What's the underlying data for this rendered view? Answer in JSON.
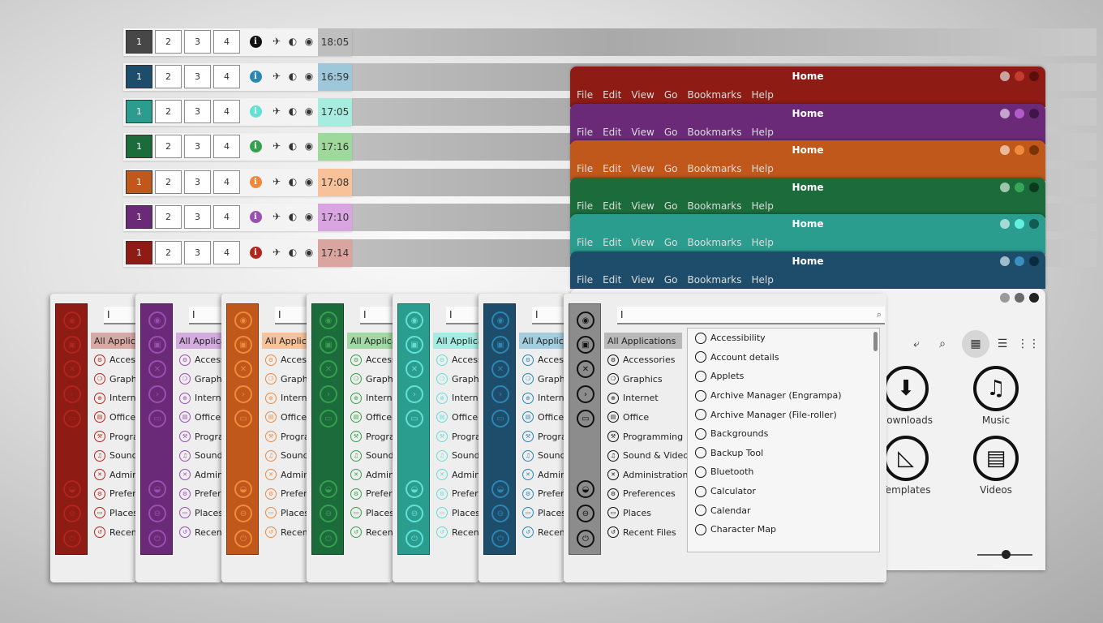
{
  "panels": [
    {
      "active": "#474747",
      "info": "#111111",
      "clock": "18:05",
      "clock_bg": "#bebebe"
    },
    {
      "active": "#1e4d6b",
      "info": "#2b86b3",
      "clock": "16:59",
      "clock_bg": "#9ec7d9"
    },
    {
      "active": "#2a9d8f",
      "info": "#63e0d4",
      "clock": "17:05",
      "clock_bg": "#a6ecdf"
    },
    {
      "active": "#1c6b3a",
      "info": "#35a14f",
      "clock": "17:16",
      "clock_bg": "#9fd89b"
    },
    {
      "active": "#c0581b",
      "info": "#f0883c",
      "clock": "17:08",
      "clock_bg": "#f7c29a"
    },
    {
      "active": "#6a2a78",
      "info": "#9b4fb1",
      "clock": "17:10",
      "clock_bg": "#d9a5e0"
    },
    {
      "active": "#8e1b14",
      "info": "#b0251c",
      "clock": "17:14",
      "clock_bg": "#dba59f"
    }
  ],
  "workspaces": [
    "1",
    "2",
    "3",
    "4"
  ],
  "filemanager": {
    "title": "Home",
    "menus": [
      "File",
      "Edit",
      "View",
      "Go",
      "Bookmarks",
      "Help"
    ],
    "themes": [
      {
        "bar": "#8e1b14",
        "dots": [
          "#c9a3a0",
          "#c03d30",
          "#5a0f0b"
        ]
      },
      {
        "bar": "#6a2a78",
        "dots": [
          "#c4a3cc",
          "#b25cc9",
          "#3f1548"
        ]
      },
      {
        "bar": "#c0581b",
        "dots": [
          "#e9b99a",
          "#f08a3c",
          "#7a3306"
        ]
      },
      {
        "bar": "#1c6b3a",
        "dots": [
          "#9cc6aa",
          "#36a758",
          "#0c3a1d"
        ]
      },
      {
        "bar": "#2a9d8f",
        "dots": [
          "#a4dbd3",
          "#63f0e0",
          "#135a52"
        ]
      },
      {
        "bar": "#1e4d6b",
        "dots": [
          "#9ebccc",
          "#3a8fbf",
          "#0b2a3e"
        ]
      }
    ],
    "base_dots": [
      "#9a9a9a",
      "#6a6a6a",
      "#222222"
    ],
    "folders": [
      {
        "label": "Downloads",
        "icon": "down-arrow-icon"
      },
      {
        "label": "Music",
        "icon": "music-note-icon"
      },
      {
        "label": "Templates",
        "icon": "set-square-icon"
      },
      {
        "label": "Videos",
        "icon": "film-icon"
      }
    ]
  },
  "menus": {
    "search_value": "I",
    "themes": [
      {
        "side": "#8e1b14",
        "accent": "#b0251c",
        "hl": "#d7a9a5"
      },
      {
        "side": "#6a2a78",
        "accent": "#9b4fb1",
        "hl": "#d4ace0"
      },
      {
        "side": "#c0581b",
        "accent": "#f08a3c",
        "hl": "#f6c39c"
      },
      {
        "side": "#1c6b3a",
        "accent": "#35a14f",
        "hl": "#a2d9a4"
      },
      {
        "side": "#2a9d8f",
        "accent": "#63e0d4",
        "hl": "#a6ece2"
      },
      {
        "side": "#1e4d6b",
        "accent": "#2b86b3",
        "hl": "#a4cde0"
      },
      {
        "side": "#8c8c8c",
        "accent": "#111111",
        "hl": "#b9b9b9"
      }
    ],
    "categories": [
      "All Applications",
      "Accessories",
      "Graphics",
      "Internet",
      "Office",
      "Programming",
      "Sound & Video",
      "Administration",
      "Preferences",
      "Places",
      "Recent Files"
    ],
    "apps": [
      "Accessibility",
      "Account details",
      "Applets",
      "Archive Manager (Engrampa)",
      "Archive Manager (File-roller)",
      "Backgrounds",
      "Backup Tool",
      "Bluetooth",
      "Calculator",
      "Calendar",
      "Character Map"
    ]
  }
}
